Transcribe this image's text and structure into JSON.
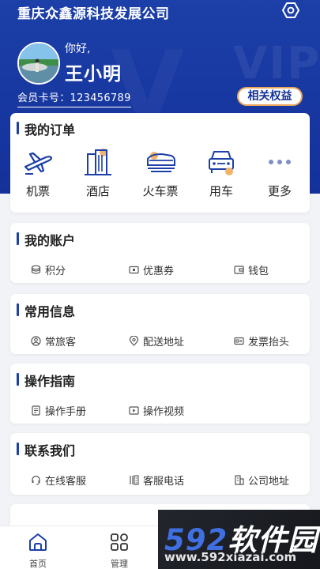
{
  "header": {
    "company": "重庆众鑫源科技发展公司",
    "greeting": "你好,",
    "username": "王小明",
    "card_no": "会员卡号：123456789",
    "rights_button": "相关权益",
    "settings_icon": "gear-icon"
  },
  "orders": {
    "title": "我的订单",
    "items": [
      {
        "label": "机票",
        "icon": "plane-icon"
      },
      {
        "label": "酒店",
        "icon": "hotel-icon"
      },
      {
        "label": "火车票",
        "icon": "train-icon"
      },
      {
        "label": "用车",
        "icon": "car-icon"
      },
      {
        "label": "更多",
        "icon": "more-icon"
      }
    ]
  },
  "account": {
    "title": "我的账户",
    "items": [
      {
        "label": "积分",
        "icon": "coins-icon"
      },
      {
        "label": "优惠券",
        "icon": "coupon-icon"
      },
      {
        "label": "钱包",
        "icon": "wallet-icon"
      }
    ]
  },
  "common": {
    "title": "常用信息",
    "items": [
      {
        "label": "常旅客",
        "icon": "traveler-icon"
      },
      {
        "label": "配送地址",
        "icon": "location-icon"
      },
      {
        "label": "发票抬头",
        "icon": "invoice-icon"
      }
    ]
  },
  "guide": {
    "title": "操作指南",
    "items": [
      {
        "label": "操作手册",
        "icon": "manual-icon"
      },
      {
        "label": "操作视频",
        "icon": "video-icon"
      }
    ]
  },
  "contact": {
    "title": "联系我们",
    "items": [
      {
        "label": "在线客服",
        "icon": "headset-icon"
      },
      {
        "label": "客服电话",
        "icon": "phone-icon"
      },
      {
        "label": "公司地址",
        "icon": "building-icon"
      }
    ]
  },
  "tabbar": {
    "tabs": [
      {
        "label": "首页",
        "icon": "home-icon"
      },
      {
        "label": "管理",
        "icon": "grid-icon"
      }
    ]
  },
  "watermark": {
    "brand_digits": "592",
    "brand_text": "软件园",
    "url": "www.592xiazai.com"
  },
  "colors": {
    "primary": "#1c3fa8",
    "accent": "#e9a55b",
    "background": "#f2f3f7"
  }
}
